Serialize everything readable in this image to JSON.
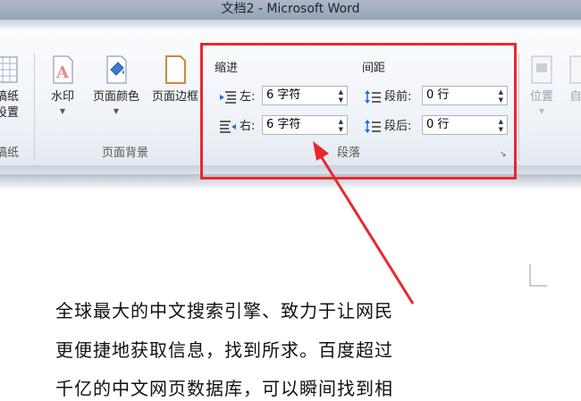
{
  "window": {
    "title": "文档2  -  Microsoft Word"
  },
  "ribbon": {
    "left_partial": {
      "label_line1": "稿纸",
      "label_line2": "设置",
      "group": "稿纸"
    },
    "page_background": {
      "group_label": "页面背景",
      "watermark": "水印",
      "page_color": "页面颜色",
      "page_border": "页面边框"
    },
    "paragraph": {
      "group_label": "段落",
      "indent_header": "缩进",
      "spacing_header": "间距",
      "indent_left_label": "左:",
      "indent_left_value": "6 字符",
      "indent_right_label": "右:",
      "indent_right_value": "6 字符",
      "spacing_before_label": "段前:",
      "spacing_before_value": "0 行",
      "spacing_after_label": "段后:",
      "spacing_after_value": "0 行"
    },
    "arrange_partial": {
      "position": "位置",
      "auto": "自"
    }
  },
  "document": {
    "lines": [
      "全球最大的中文搜索引擎、致力于让网民",
      "更便捷地获取信息，找到所求。百度超过",
      "千亿的中文网页数据库，可以瞬间找到相"
    ]
  },
  "colors": {
    "highlight": "#e8282e",
    "accent": "#2b579a"
  }
}
